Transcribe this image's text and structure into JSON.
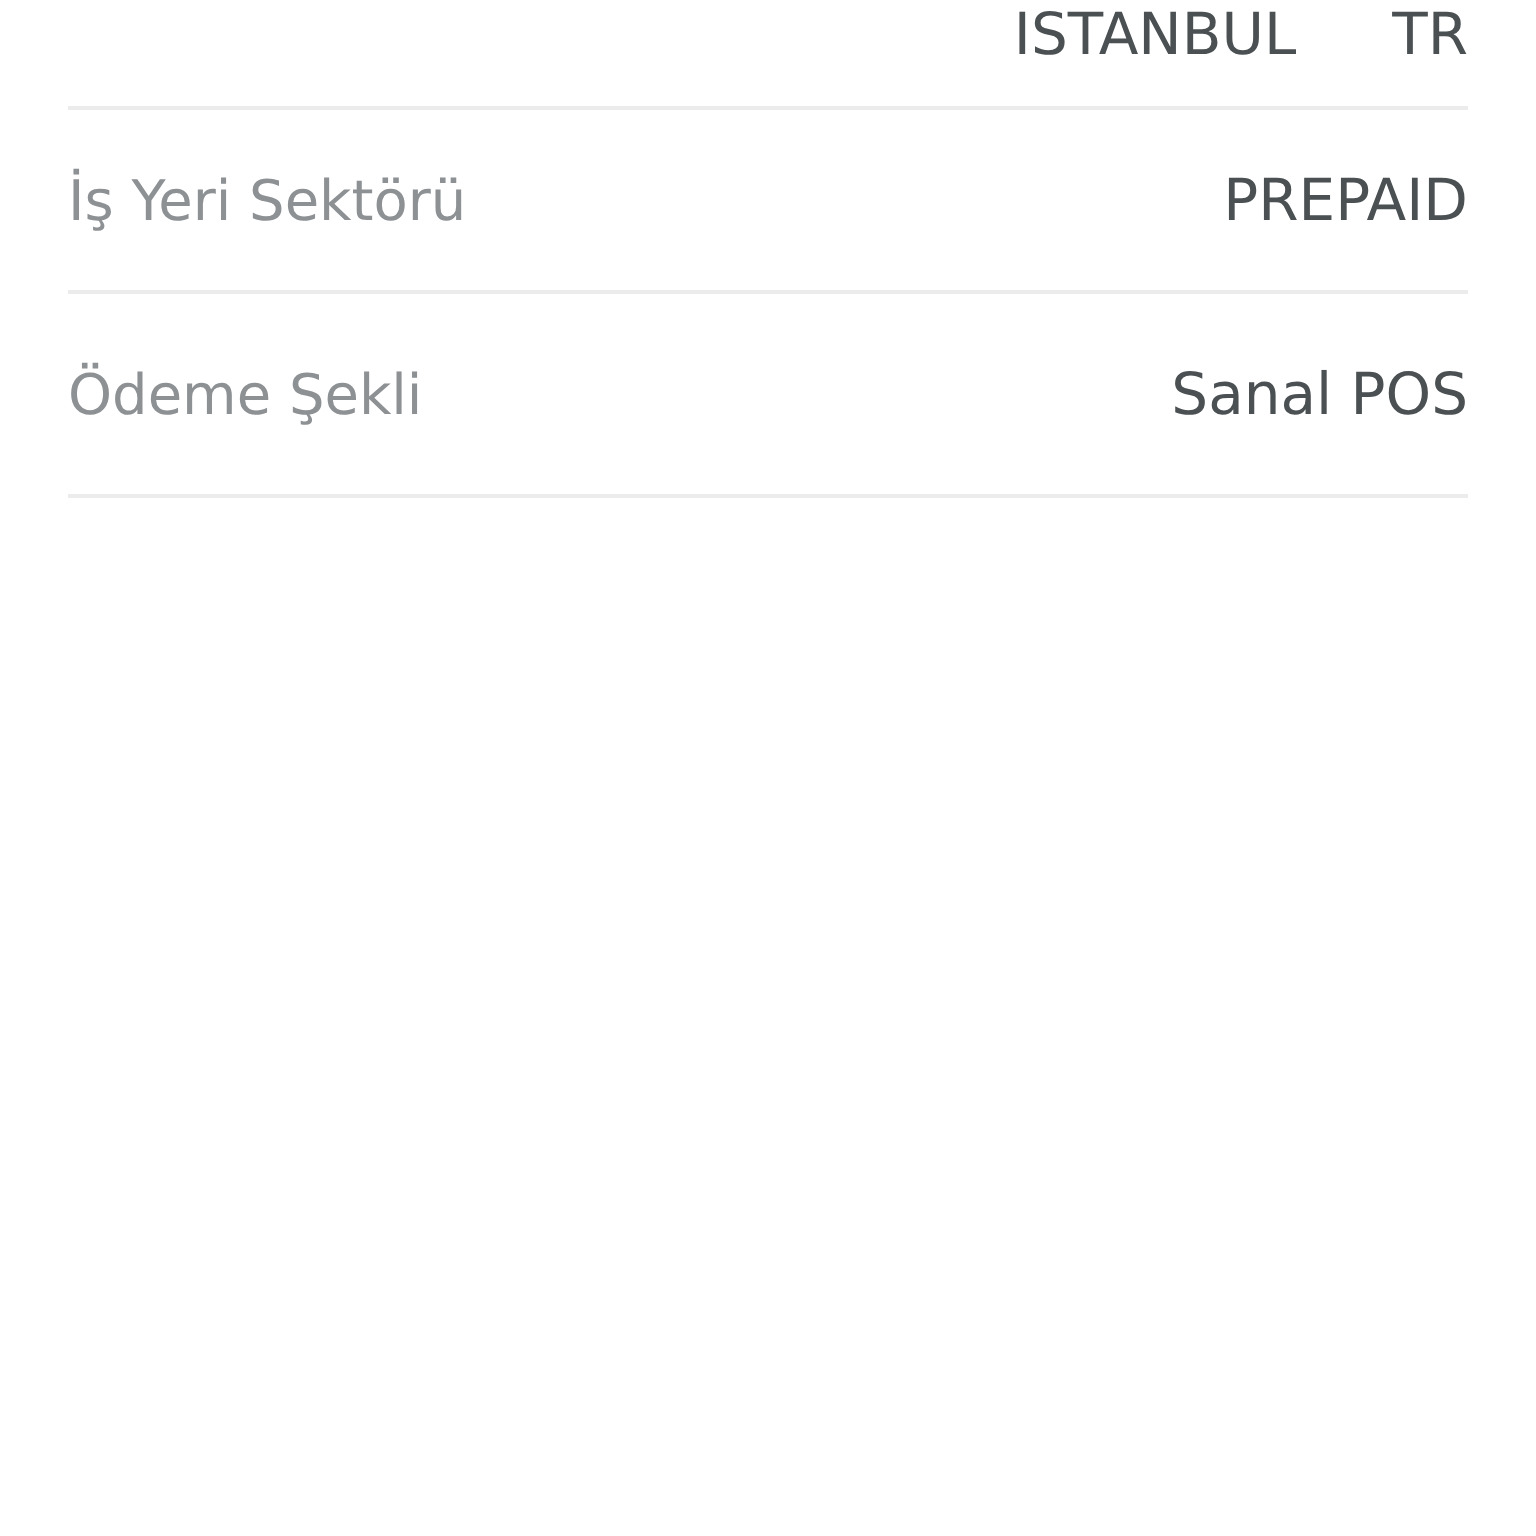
{
  "rows": [
    {
      "label": null,
      "values": [
        "ISTANBUL",
        "TR"
      ]
    },
    {
      "label": "İş Yeri Sektörü",
      "values": [
        "PREPAID"
      ]
    },
    {
      "label": "Ödeme Şekli",
      "values": [
        "Sanal POS"
      ]
    }
  ]
}
